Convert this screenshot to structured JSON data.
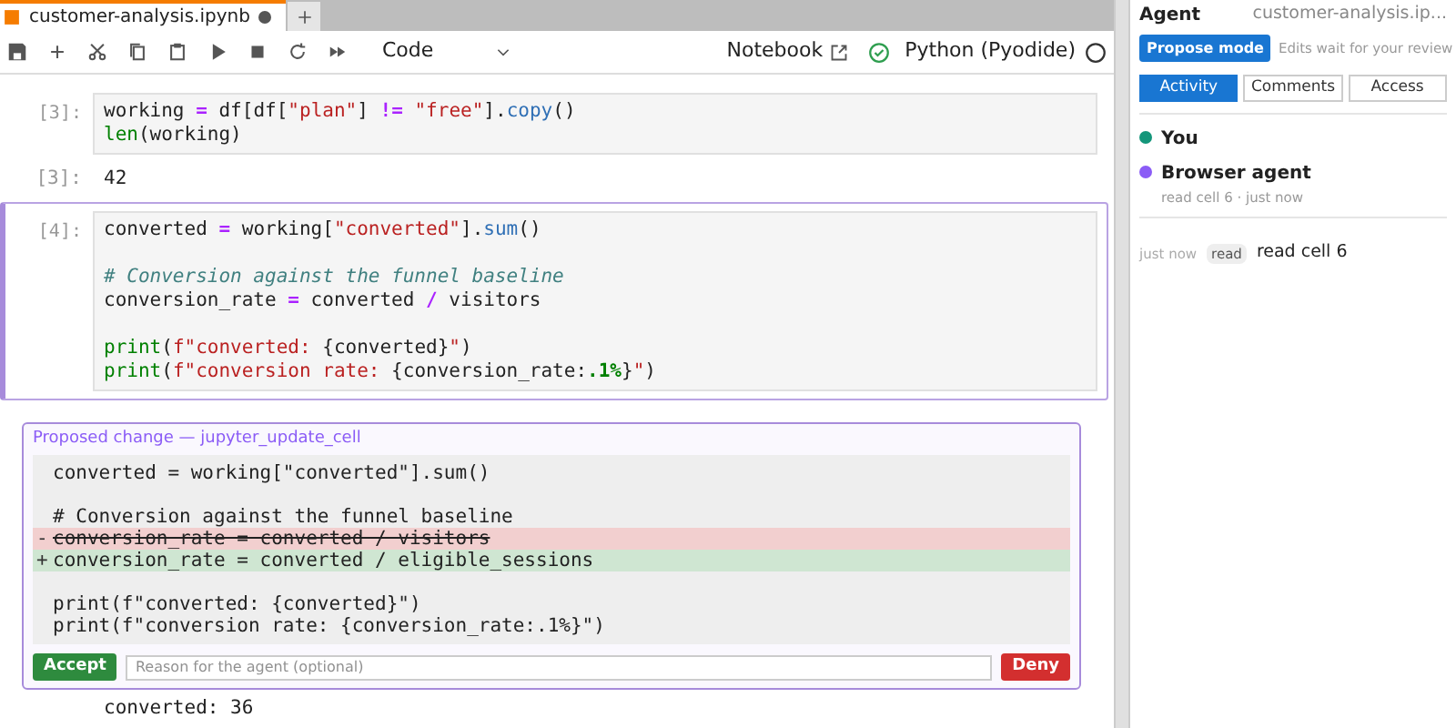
{
  "tabs": [
    {
      "label": "customer-analysis.ipynb",
      "selected": true,
      "unsaved": true
    }
  ],
  "toolbar": {
    "cell_type": "Code",
    "notebook_link": "Notebook",
    "kernel": "Python (Pyodide)"
  },
  "cells": [
    {
      "kind": "code",
      "prompt": "[3]:",
      "selected": false,
      "lines": [
        {
          "kind": "code",
          "tokens": [
            {
              "text": "working ",
              "kind": "plain"
            },
            {
              "text": "=",
              "kind": "operator"
            },
            {
              "text": " df[df[",
              "kind": "plain"
            },
            {
              "text": "\"plan\"",
              "kind": "string"
            },
            {
              "text": "] ",
              "kind": "plain"
            },
            {
              "text": "!= ",
              "kind": "operator"
            },
            {
              "text": "\"free\"",
              "kind": "string"
            },
            {
              "text": "].",
              "kind": "plain"
            },
            {
              "text": "copy",
              "kind": "method"
            },
            {
              "text": "()",
              "kind": "plain"
            }
          ]
        },
        {
          "kind": "code",
          "tokens": [
            {
              "text": "len",
              "kind": "builtin"
            },
            {
              "text": "(working)",
              "kind": "plain"
            }
          ]
        }
      ]
    },
    {
      "kind": "output",
      "prompt": "[3]:",
      "text": "42"
    },
    {
      "kind": "code",
      "prompt": "[4]:",
      "selected": true,
      "lines": [
        {
          "kind": "code",
          "tokens": [
            {
              "text": "converted ",
              "kind": "plain"
            },
            {
              "text": "=",
              "kind": "operator"
            },
            {
              "text": " working[",
              "kind": "plain"
            },
            {
              "text": "\"converted\"",
              "kind": "string"
            },
            {
              "text": "].",
              "kind": "plain"
            },
            {
              "text": "sum",
              "kind": "method"
            },
            {
              "text": "()",
              "kind": "plain"
            }
          ]
        },
        {
          "kind": "blank"
        },
        {
          "kind": "code",
          "tokens": [
            {
              "text": "# Conversion against the funnel baseline",
              "kind": "comment"
            }
          ]
        },
        {
          "kind": "code",
          "tokens": [
            {
              "text": "conversion_rate ",
              "kind": "plain"
            },
            {
              "text": "=",
              "kind": "operator"
            },
            {
              "text": " converted ",
              "kind": "plain"
            },
            {
              "text": "/",
              "kind": "operator"
            },
            {
              "text": " visitors",
              "kind": "plain"
            }
          ]
        },
        {
          "kind": "blank"
        },
        {
          "kind": "code",
          "tokens": [
            {
              "text": "print",
              "kind": "builtin"
            },
            {
              "text": "(",
              "kind": "plain"
            },
            {
              "text": "f\"converted: ",
              "kind": "string"
            },
            {
              "text": "{converted}",
              "kind": "plain"
            },
            {
              "text": "\"",
              "kind": "string"
            },
            {
              "text": ")",
              "kind": "plain"
            }
          ]
        },
        {
          "kind": "code",
          "tokens": [
            {
              "text": "print",
              "kind": "builtin"
            },
            {
              "text": "(",
              "kind": "plain"
            },
            {
              "text": "f\"conversion rate: ",
              "kind": "string"
            },
            {
              "text": "{conversion_rate:",
              "kind": "plain"
            },
            {
              "text": ".1%",
              "kind": "format"
            },
            {
              "text": "}",
              "kind": "plain"
            },
            {
              "text": "\"",
              "kind": "string"
            },
            {
              "text": ")",
              "kind": "plain"
            }
          ]
        }
      ]
    },
    {
      "kind": "proposal",
      "title": "Proposed change — jupyter_update_cell",
      "lines": [
        {
          "kind": "same",
          "text": "converted = working[\"converted\"].sum()"
        },
        {
          "kind": "blank"
        },
        {
          "kind": "same",
          "text": "# Conversion against the funnel baseline"
        },
        {
          "kind": "del",
          "marker": "-",
          "text": "conversion_rate = converted / visitors"
        },
        {
          "kind": "add",
          "marker": "+",
          "text": "conversion_rate = converted / eligible_sessions"
        },
        {
          "kind": "blank"
        },
        {
          "kind": "same",
          "text": "print(f\"converted: {converted}\")"
        },
        {
          "kind": "same",
          "text": "print(f\"conversion rate: {conversion_rate:.1%}\")"
        }
      ],
      "accept": "Accept",
      "reason_placeholder": "Reason for the agent (optional)",
      "deny": "Deny"
    },
    {
      "kind": "output",
      "text": "converted: 36"
    }
  ],
  "agent_panel": {
    "title": "Agent",
    "file": "customer-analysis.ip...",
    "mode_button": "Propose mode",
    "mode_hint": "Edits wait for your review",
    "tabs": [
      {
        "label": "Activity",
        "selected": true
      },
      {
        "label": "Comments",
        "selected": false
      },
      {
        "label": "Access",
        "selected": false
      }
    ],
    "participants": [
      {
        "name": "You",
        "color": "#14967a"
      },
      {
        "name": "Browser agent",
        "color": "#8b5cf6",
        "detail": "read cell 6 · just now"
      }
    ],
    "activity": [
      {
        "time": "just now",
        "tag": "read",
        "text": "read cell 6"
      }
    ]
  }
}
